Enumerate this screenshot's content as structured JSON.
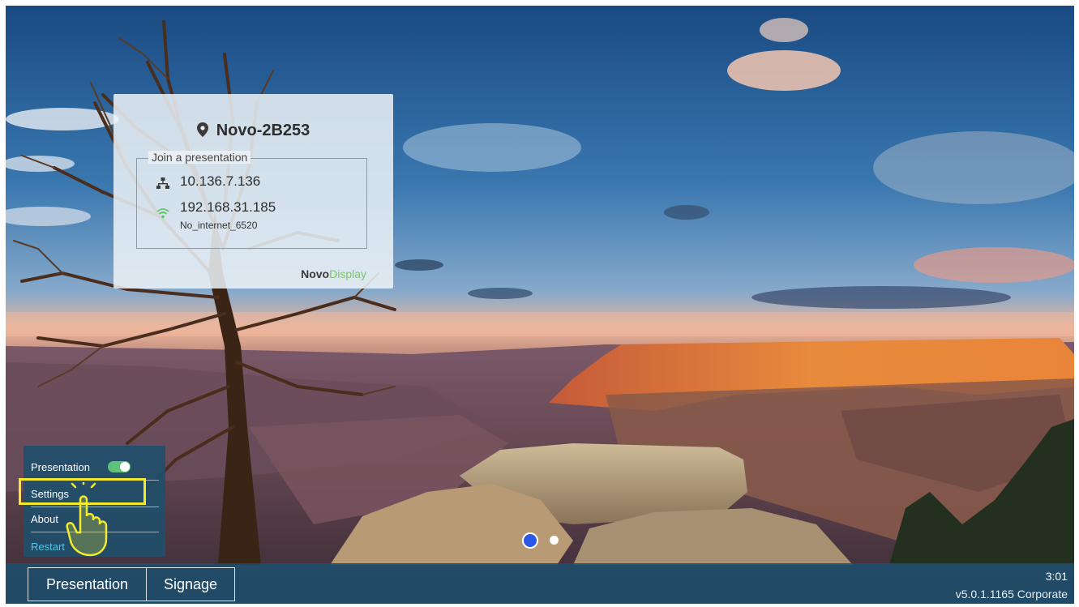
{
  "info_card": {
    "device_name": "Novo-2B253",
    "join_label": "Join a presentation",
    "ethernet_ip": "10.136.7.136",
    "wifi_ip": "192.168.31.185",
    "wifi_ssid": "No_internet_6520",
    "brand_part1": "Novo",
    "brand_part2": "Display",
    "icons": [
      "location-pin-icon",
      "ethernet-icon",
      "wifi-icon"
    ]
  },
  "side_menu": {
    "items": [
      {
        "label": "Presentation",
        "toggle_on": true
      },
      {
        "label": "Settings",
        "highlighted": true
      },
      {
        "label": "About"
      },
      {
        "label": "Restart"
      }
    ]
  },
  "pager": {
    "total": 2,
    "active": 1
  },
  "bottom_bar": {
    "tabs": [
      "Presentation",
      "Signage"
    ],
    "clock": "3:01",
    "version": "v5.0.1.1165 Corporate"
  },
  "colors": {
    "accent_toggle": "#5fc27a",
    "restart_link": "#4fc6e6",
    "highlight": "#f5ea2a",
    "active_dot": "#2a57e6",
    "brand_green": "#7cc46a"
  }
}
